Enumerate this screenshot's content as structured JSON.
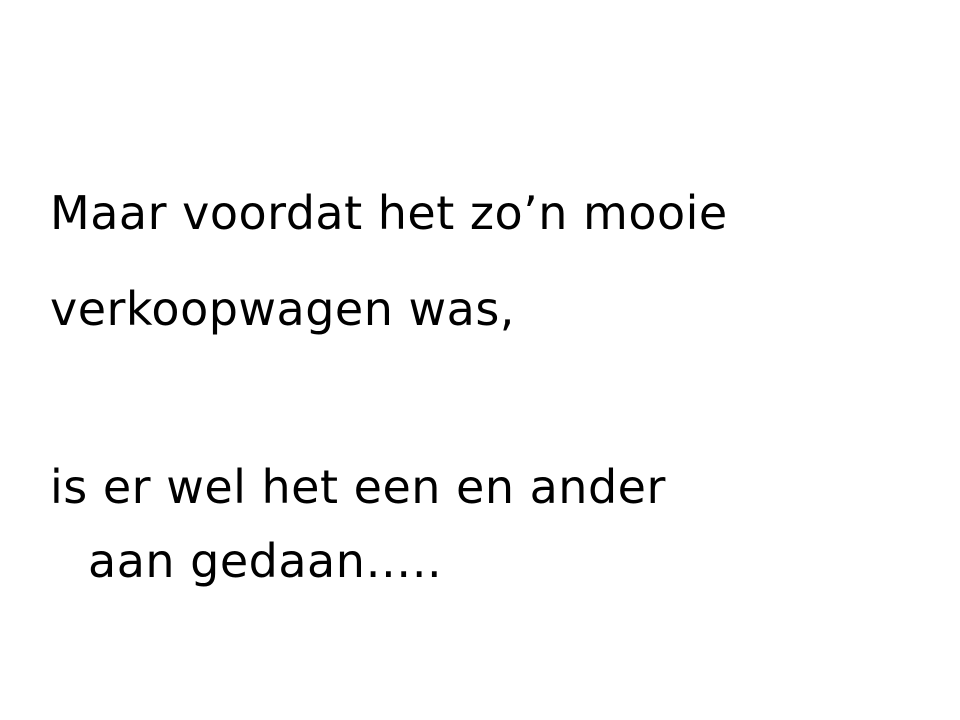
{
  "slide": {
    "lines": [
      "Maar voordat het zo’n mooie",
      "verkoopwagen was,",
      "is er wel het een en ander",
      "aan gedaan….."
    ]
  }
}
